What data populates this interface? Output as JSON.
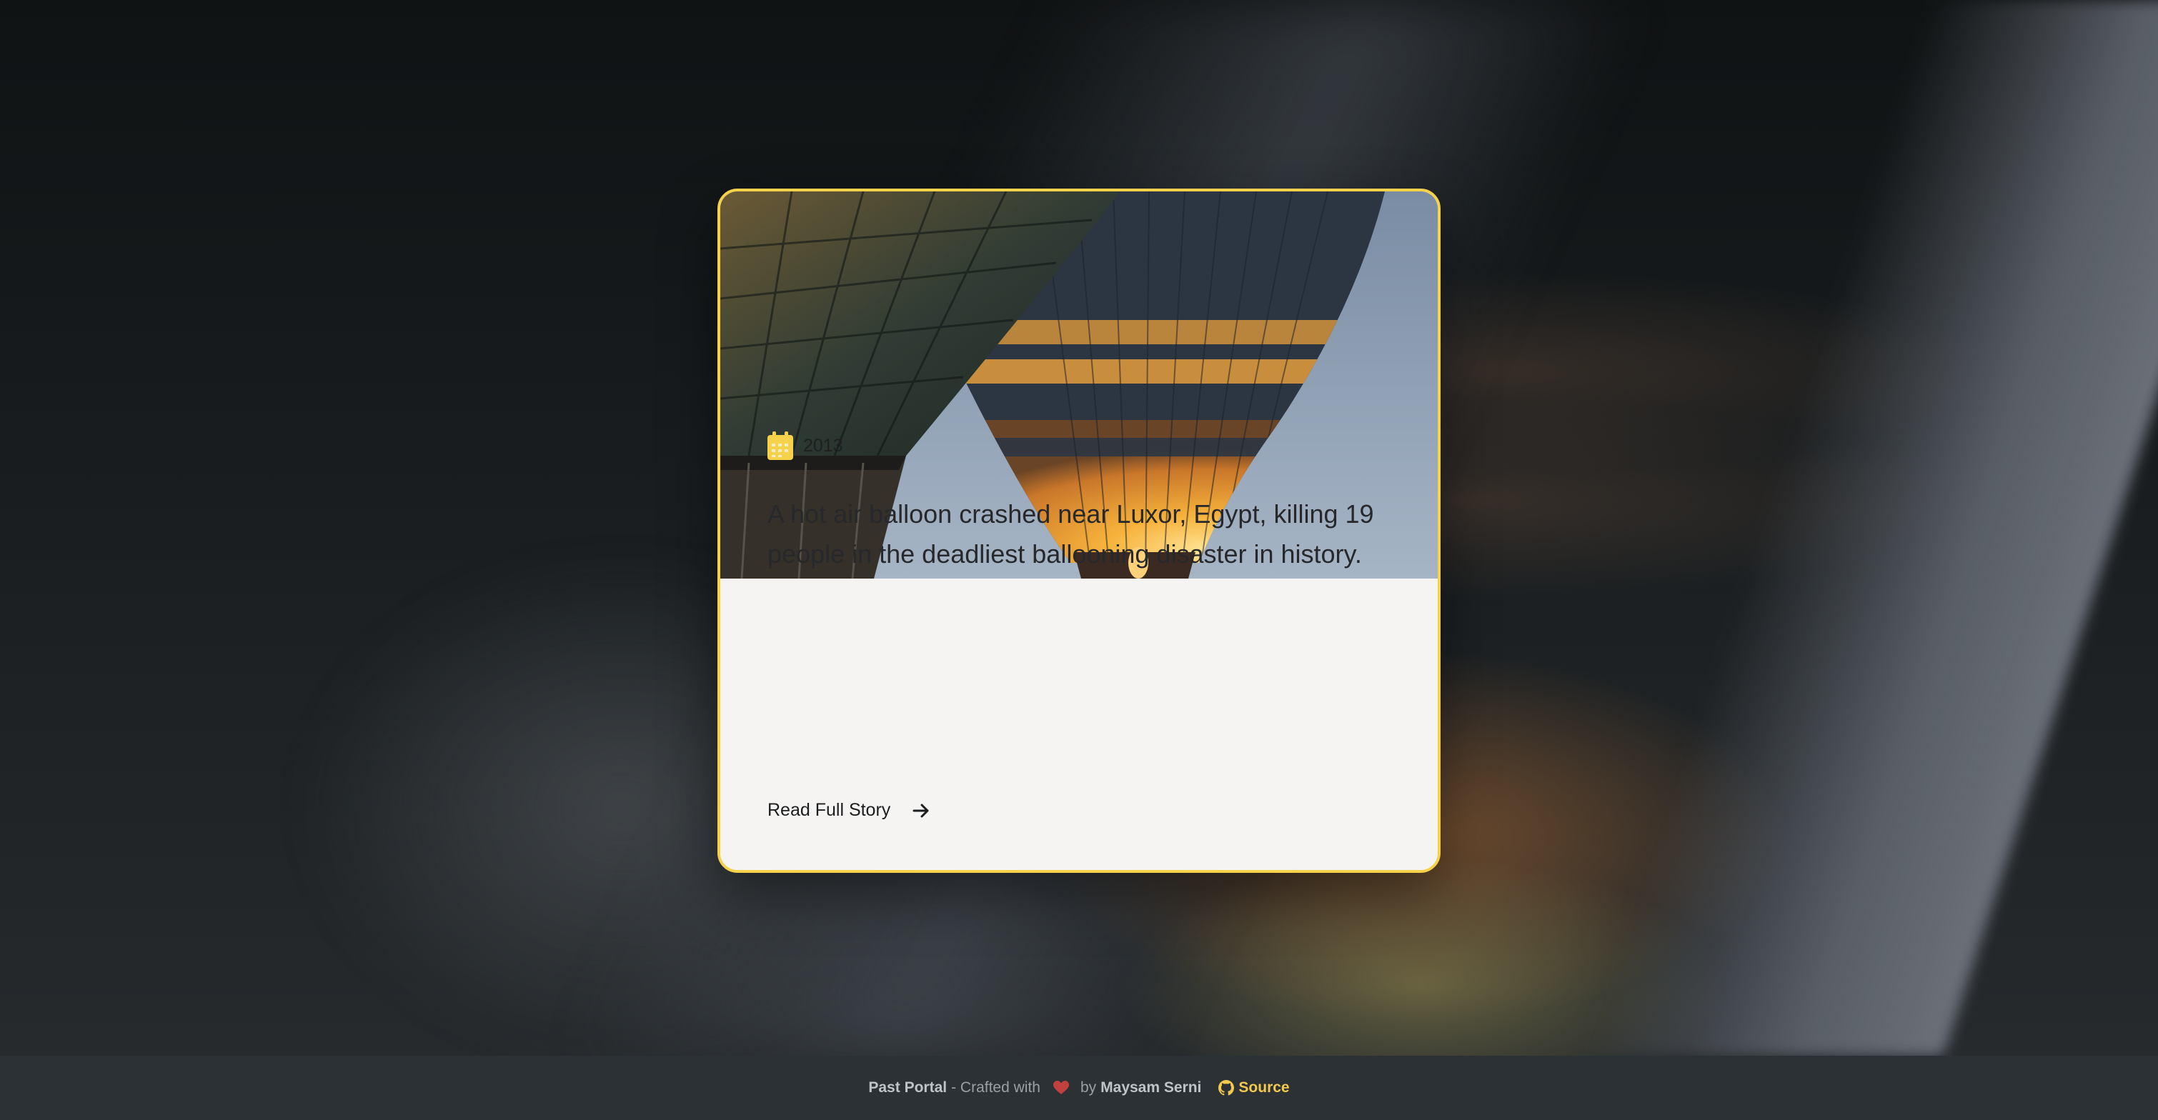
{
  "card": {
    "image_alt": "hot air balloons",
    "date_icon": "calendar-icon",
    "year": "2013",
    "description": "A hot air balloon crashed near Luxor, Egypt, killing 19 people in the deadliest ballooning disaster in history.",
    "read_more_label": "Read Full Story",
    "read_more_icon": "arrow-right-icon"
  },
  "footer": {
    "brand": "Past Portal",
    "crafted_text": "- Crafted with",
    "heart_icon": "heart-icon",
    "by_text": "by",
    "author": "Maysam Serni",
    "source_icon": "github-icon",
    "source_label": "Source"
  },
  "colors": {
    "accent": "#f6d24a",
    "card_background": "#f5f4f3",
    "footer_background": "#2b3135",
    "heart": "#c0413e",
    "source_link": "#f2c94c"
  }
}
